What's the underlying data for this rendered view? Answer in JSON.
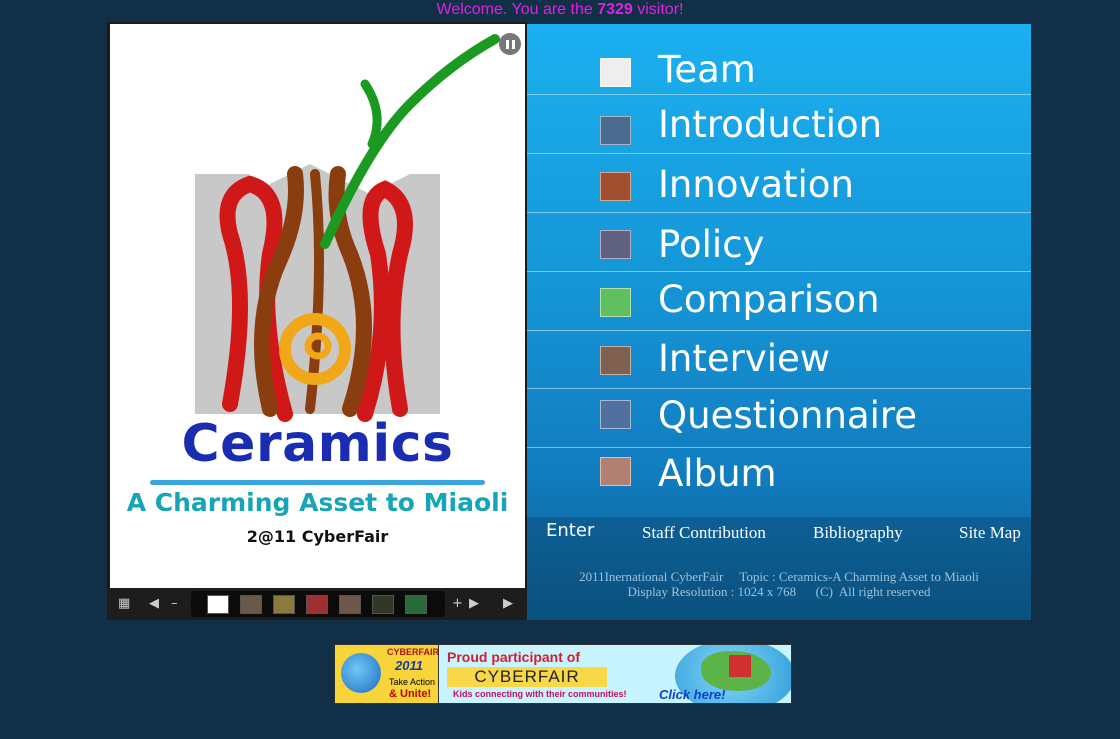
{
  "welcome": {
    "prefix": "Welcome. You are the",
    "count": "7329",
    "suffix": "visitor!"
  },
  "slideshow": {
    "logo_title": "Ceramics",
    "logo_subtitle": "A Charming Asset to Miaoli",
    "logo_event": "2@11 CyberFair",
    "thumbnails": [
      "logo",
      "photo-1",
      "photo-2",
      "photo-3",
      "photo-4",
      "photo-5",
      "photo-6"
    ],
    "controls": {
      "grid_icon": "grid-icon",
      "first_icon": "first-icon",
      "minus_icon": "minus-icon",
      "plus_icon": "plus-icon",
      "last_icon": "last-icon",
      "play_icon": "play-icon",
      "pause_icon": "pause-icon"
    }
  },
  "nav": {
    "items": [
      {
        "label": "Team",
        "thumb_color": "#e8e0d0"
      },
      {
        "label": "Introduction",
        "thumb_color": "#4a6a90"
      },
      {
        "label": "Innovation",
        "thumb_color": "#a05030"
      },
      {
        "label": "Policy",
        "thumb_color": "#606080"
      },
      {
        "label": "Comparison",
        "thumb_color": "#60c060"
      },
      {
        "label": "Interview",
        "thumb_color": "#806050"
      },
      {
        "label": "Questionnaire",
        "thumb_color": "#5070a0"
      },
      {
        "label": "Album",
        "thumb_color": "#b08070"
      }
    ],
    "links": {
      "enter": "Enter",
      "staff": "Staff Contribution",
      "bibliography": "Bibliography",
      "sitemap": "Site Map"
    },
    "footer": {
      "line1": "2011Inernational CyberFair     Topic : Ceramics-A Charming Asset to Miaoli",
      "line2": "Display Resolution : 1024 x 768      (C)  All right reserved"
    }
  },
  "banner": {
    "cyberfair_small": "CYBERFAIR",
    "year": "2011",
    "take_action": "Take Action",
    "unite": "& Unite!",
    "proud": "Proud participant of",
    "logo": "CYBERFAIR",
    "kids": "Kids connecting with their communities!",
    "click": "Click here!"
  }
}
